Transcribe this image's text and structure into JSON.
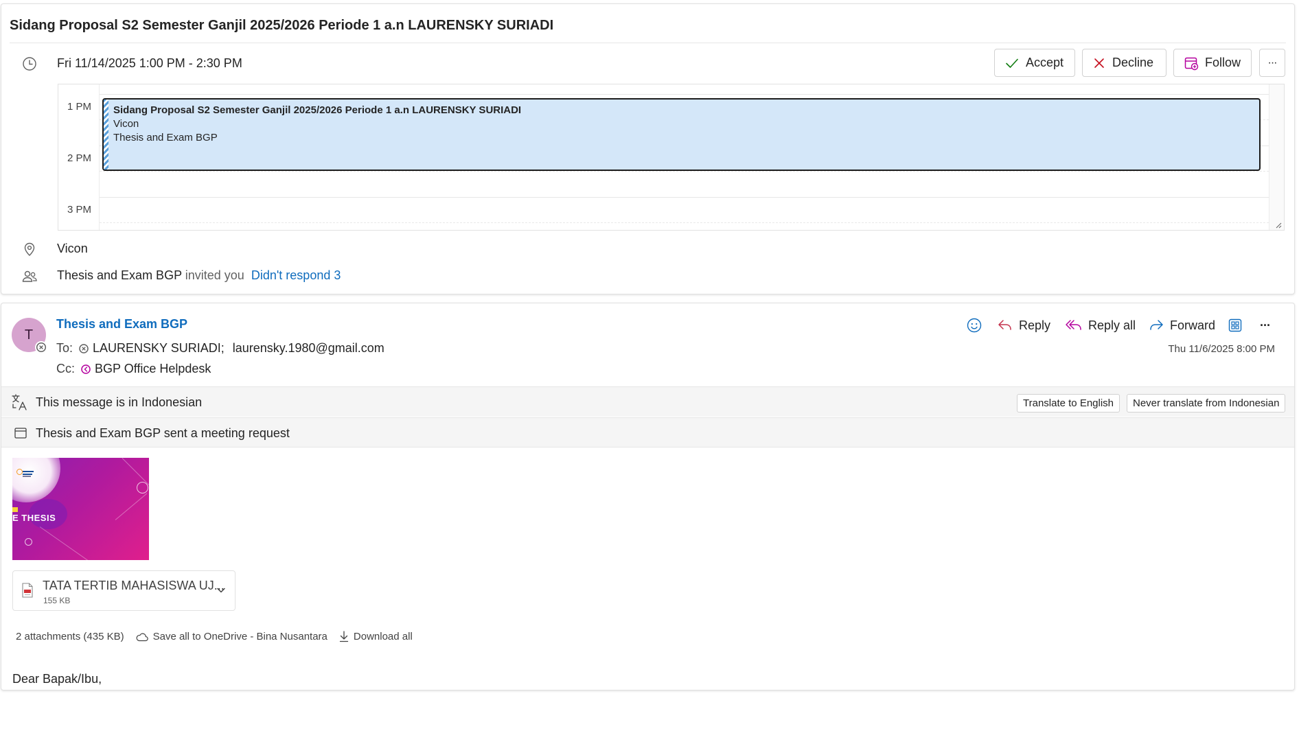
{
  "meeting": {
    "title": "Sidang Proposal S2 Semester Ganjil 2025/2026 Periode 1 a.n LAURENSKY SURIADI",
    "when": "Fri 11/14/2025 1:00 PM - 2:30 PM",
    "buttons": {
      "accept": "Accept",
      "decline": "Decline",
      "follow": "Follow",
      "more": "···"
    },
    "timeline": {
      "hours": [
        "1 PM",
        "2 PM",
        "3 PM"
      ],
      "event": {
        "title": "Sidang Proposal S2 Semester Ganjil 2025/2026 Periode 1 a.n LAURENSKY SURIADI",
        "location": "Vicon",
        "organizer": "Thesis and Exam BGP"
      }
    },
    "location": "Vicon",
    "attendees": {
      "organizer": "Thesis and Exam BGP",
      "invited_text": "invited you",
      "didnt_respond": "Didn't respond 3"
    },
    "icons": [
      "clock-icon",
      "location-pin-icon",
      "people-icon"
    ]
  },
  "email": {
    "avatar_initial": "T",
    "sender": "Thesis and Exam BGP",
    "to_label": "To:",
    "to_recipients": [
      "LAURENSKY SURIADI;",
      "laurensky.1980@gmail.com"
    ],
    "cc_label": "Cc:",
    "cc_recipients": [
      "BGP Office Helpdesk"
    ],
    "date": "Thu 11/6/2025 8:00 PM",
    "actions": {
      "reply": "Reply",
      "reply_all": "Reply all",
      "forward": "Forward",
      "more": "···"
    },
    "translate": {
      "message": "This message is in Indonesian",
      "translate_button": "Translate to English",
      "never_button": "Never translate from Indonesian"
    },
    "meeting_request_text": "Thesis and Exam BGP sent a meeting request",
    "image_text": "E THESIS",
    "attachment": {
      "name": "TATA TERTIB MAHASISWA UJ...",
      "size": "155 KB",
      "type": "pdf"
    },
    "attachments_footer": {
      "summary": "2 attachments (435 KB)",
      "save_all": "Save all to OneDrive - Bina Nusantara",
      "download_all": "Download all"
    },
    "greeting": "Dear Bapak/Ibu,"
  },
  "colors": {
    "accent": "#0f6cbd",
    "event_fill": "#d4e7f9",
    "avatar": "#d6a3ce",
    "decline": "#c50f1f",
    "accept": "#107c10",
    "follow": "#b4009e"
  }
}
